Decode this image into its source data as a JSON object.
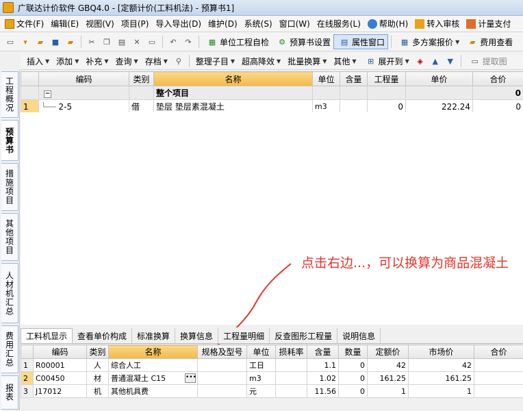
{
  "window": {
    "title": "广联达计价软件 GBQ4.0 - [定额计价(工料机法) - 预算书1]"
  },
  "menu": [
    {
      "label": "文件(F)",
      "icon": "file-icon"
    },
    {
      "label": "编辑(E)",
      "icon": "edit-icon"
    },
    {
      "label": "视图(V)",
      "icon": ""
    },
    {
      "label": "项目(P)",
      "icon": ""
    },
    {
      "label": "导入导出(D)",
      "icon": ""
    },
    {
      "label": "维护(D)",
      "icon": ""
    },
    {
      "label": "系统(S)",
      "icon": ""
    },
    {
      "label": "窗口(W)",
      "icon": ""
    },
    {
      "label": "在线服务(L)",
      "icon": ""
    },
    {
      "label": "帮助(H)",
      "icon": "help-icon"
    },
    {
      "label": "转入审核",
      "icon": "review-icon"
    },
    {
      "label": "计量支付",
      "icon": "payment-icon"
    }
  ],
  "toolbar1": {
    "self_check": "单位工程自检",
    "budget_settings": "预算书设置",
    "property_window": "属性窗口",
    "multi_quote": "多方案报价",
    "fee_view": "费用查看"
  },
  "toolbar2": {
    "insert": "插入",
    "add": "添加",
    "supplement": "补充",
    "query": "查询",
    "archive": "存档",
    "organize": "整理子目",
    "height_reduce": "超高降效",
    "batch_convert": "批量换算",
    "other": "其他",
    "expand_to": "展开到",
    "extract": "提取图"
  },
  "sidetabs": [
    "工程概况",
    "预算书",
    "措施项目",
    "其他项目",
    "人材机汇总",
    "费用汇总",
    "报表"
  ],
  "main_grid": {
    "headers": [
      "编码",
      "类别",
      "名称",
      "单位",
      "含量",
      "工程量",
      "单价",
      "合价"
    ],
    "group_row": {
      "name": "整个项目",
      "total": "0"
    },
    "rows": [
      {
        "no": "1",
        "code": "2-5",
        "type": "借",
        "name": "垫层 垫层素混凝土",
        "unit": "m3",
        "content": "",
        "qty": "0",
        "price": "222.24",
        "total": "0"
      }
    ]
  },
  "annotation": "点击右边...，可以换算为商品混凝土",
  "subtabs": [
    "工料机显示",
    "查看单价构成",
    "标准换算",
    "换算信息",
    "工程量明细",
    "反查图形工程量",
    "说明信息"
  ],
  "material_grid": {
    "headers": [
      "编码",
      "类别",
      "名称",
      "规格及型号",
      "单位",
      "损耗率",
      "含量",
      "数量",
      "定额价",
      "市场价",
      "合价"
    ],
    "rows": [
      {
        "no": "1",
        "code": "R00001",
        "type": "人",
        "name": "综合人工",
        "spec": "",
        "unit": "工日",
        "loss": "",
        "content": "1.1",
        "qty": "0",
        "quota_price": "42",
        "market_price": "42",
        "total": ""
      },
      {
        "no": "2",
        "code": "C00450",
        "type": "材",
        "name": "普通混凝土 C15",
        "spec": "",
        "unit": "m3",
        "loss": "",
        "content": "1.02",
        "qty": "0",
        "quota_price": "161.25",
        "market_price": "161.25",
        "total": ""
      },
      {
        "no": "3",
        "code": "J17012",
        "type": "机",
        "name": "其他机具费",
        "spec": "",
        "unit": "元",
        "loss": "",
        "content": "11.56",
        "qty": "0",
        "quota_price": "1",
        "market_price": "1",
        "total": ""
      }
    ]
  },
  "colors": {
    "accent": "#f3b94a",
    "annotation": "#e5332a",
    "title_bar": "#c5d6ec"
  }
}
